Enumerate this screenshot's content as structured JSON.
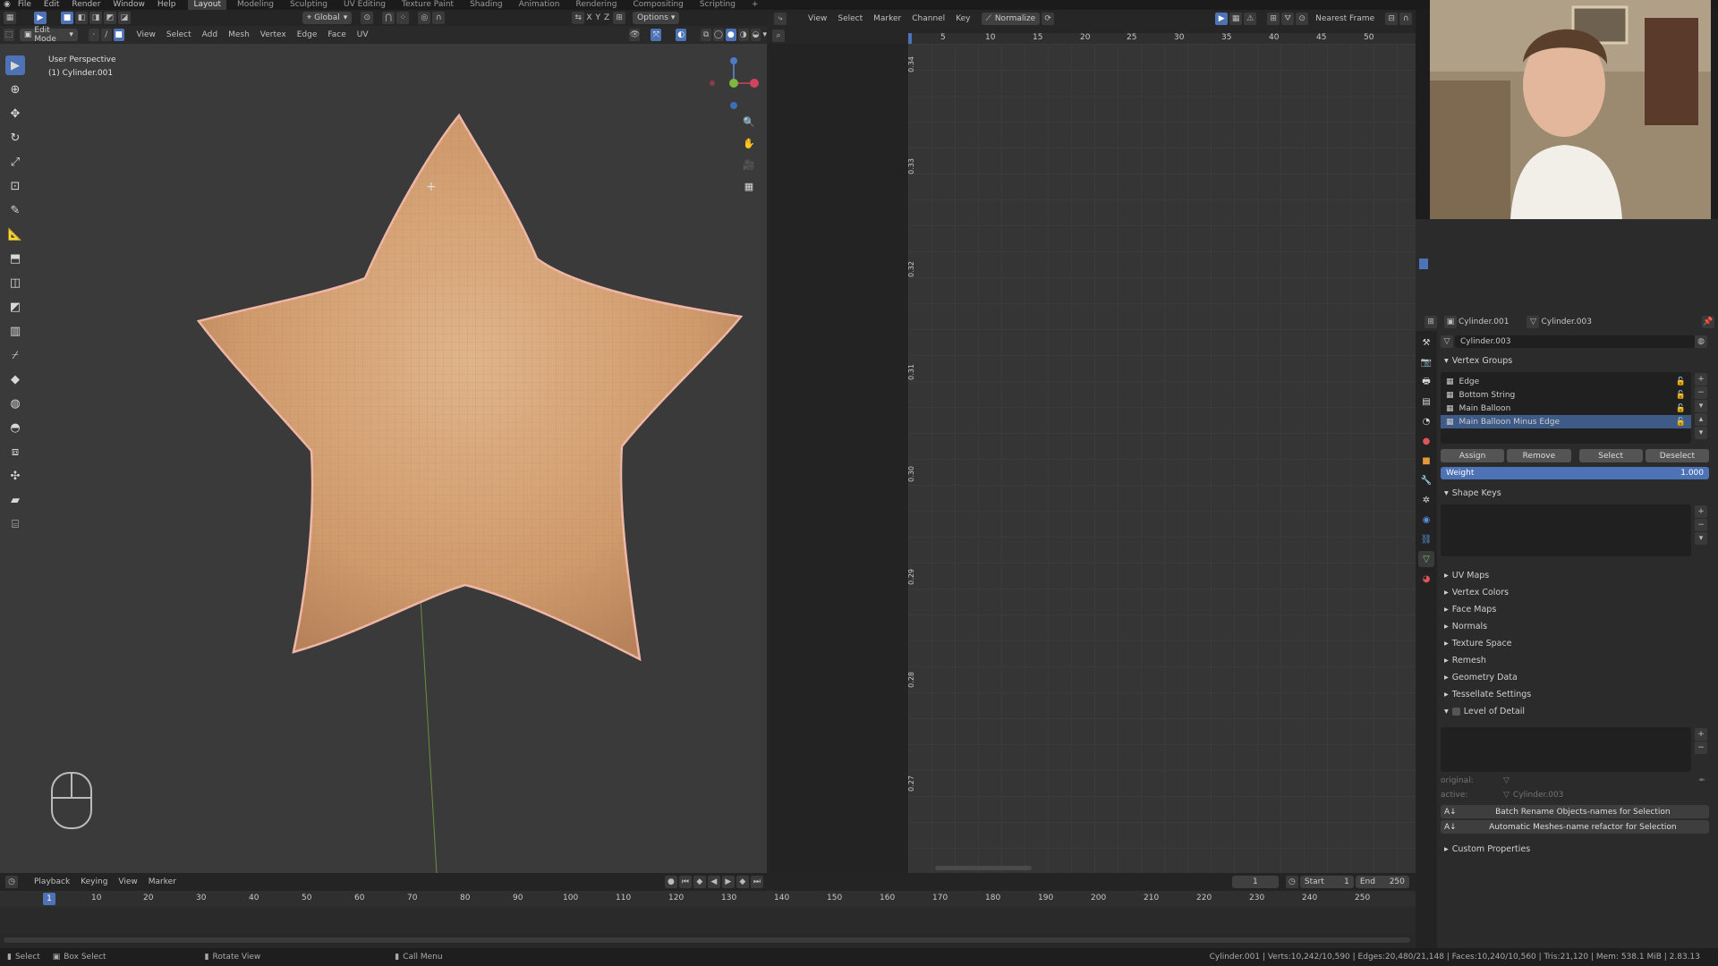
{
  "menu": {
    "items": [
      "File",
      "Edit",
      "Render",
      "Window",
      "Help"
    ],
    "workspaces": [
      "Layout",
      "Modeling",
      "Sculpting",
      "UV Editing",
      "Texture Paint",
      "Shading",
      "Animation",
      "Rendering",
      "Compositing",
      "Scripting"
    ],
    "active_workspace": "Layout",
    "add_tab": "+"
  },
  "viewport": {
    "mode": "Edit Mode",
    "menus": [
      "View",
      "Select",
      "Add",
      "Mesh",
      "Vertex",
      "Edge",
      "Face",
      "UV"
    ],
    "transform_orientation": "Global",
    "options_label": "Options",
    "axes": [
      "X",
      "Y",
      "Z"
    ],
    "info_line1": "User Perspective",
    "info_line2": "(1) Cylinder.001"
  },
  "graph_editor": {
    "menus": [
      "View",
      "Select",
      "Marker",
      "Channel",
      "Key"
    ],
    "normalize_label": "Normalize",
    "interp_label": "Nearest Frame",
    "frame_ticks": [
      "5",
      "10",
      "15",
      "20",
      "25",
      "30",
      "35",
      "40",
      "45",
      "50"
    ],
    "value_ticks": [
      "0.34",
      "0.33",
      "0.32",
      "0.31",
      "0.30",
      "0.29",
      "0.28",
      "0.27"
    ]
  },
  "properties": {
    "object_name": "Cylinder.001",
    "mesh_name": "Cylinder.003",
    "data_name": "Cylinder.003",
    "vertex_groups_title": "Vertex Groups",
    "vertex_groups": [
      "Edge",
      "Bottom String",
      "Main Balloon",
      "Main Balloon Minus Edge"
    ],
    "selected_group": "Main Balloon Minus Edge",
    "buttons": [
      "Assign",
      "Remove",
      "Select",
      "Deselect"
    ],
    "weight_label": "Weight",
    "weight_value": "1.000",
    "shape_keys_title": "Shape Keys",
    "collapsed_panels": [
      "UV Maps",
      "Vertex Colors",
      "Face Maps",
      "Normals",
      "Texture Space",
      "Remesh",
      "Geometry Data",
      "Tessellate Settings"
    ],
    "lod_title": "Level of Detail",
    "original_label": "original:",
    "active_label": "active:",
    "active_value": "Cylinder.003",
    "addon_buttons": [
      "Batch Rename Objects-names for Selection",
      "Automatic Meshes-name refactor for Selection"
    ],
    "custom_props_title": "Custom Properties"
  },
  "timeline": {
    "menus": [
      "Playback",
      "Keying",
      "View",
      "Marker"
    ],
    "current_frame": "1",
    "start_label": "Start",
    "start_value": "1",
    "end_label": "End",
    "end_value": "250",
    "ruler_ticks": [
      "1",
      "10",
      "20",
      "30",
      "40",
      "50",
      "60",
      "70",
      "80",
      "90",
      "100",
      "110",
      "120",
      "130",
      "140",
      "150",
      "160",
      "170",
      "180",
      "190",
      "200",
      "210",
      "220",
      "230",
      "240",
      "250"
    ]
  },
  "status": {
    "select": "Select",
    "box_select": "Box Select",
    "rotate_view": "Rotate View",
    "call_menu": "Call Menu",
    "stats": "Cylinder.001 | Verts:10,242/10,590 | Edges:20,480/21,148 | Faces:10,240/10,560 | Tris:21,120 | Mem: 538.1 MiB | 2.83.13"
  },
  "colors": {
    "accent": "#4d72b5",
    "star_fill": "#d8a67a",
    "star_edge": "#f0b6a6"
  }
}
